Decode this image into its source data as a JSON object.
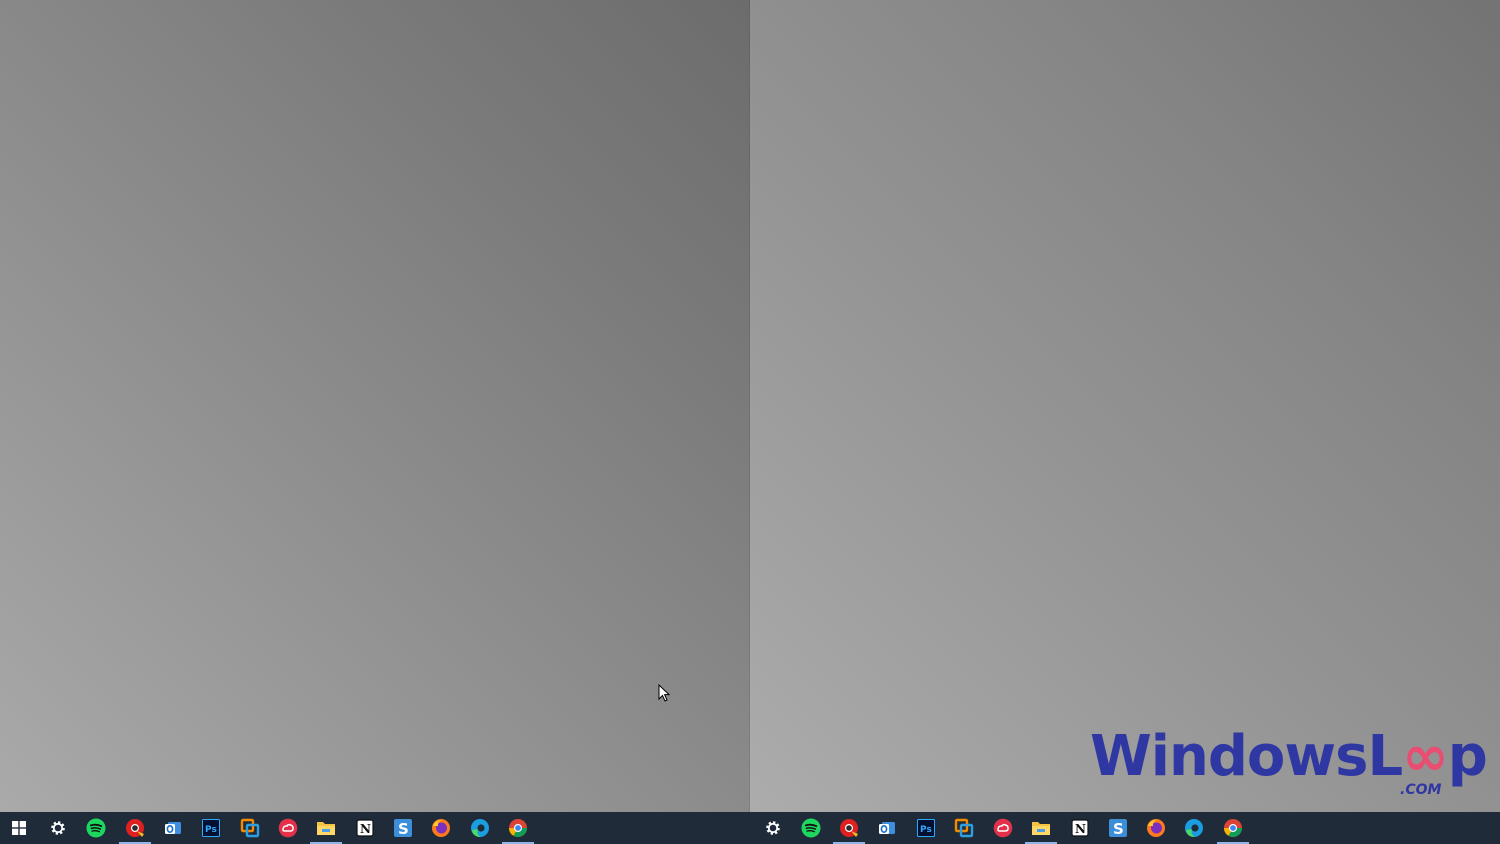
{
  "watermark": {
    "brand_main": "WindowsL",
    "brand_infinity": "∞",
    "brand_end": "p",
    "brand_suffix": ".COM",
    "colors": {
      "blue": "#2f37a3",
      "pink": "#e94e72"
    }
  },
  "taskbar_colors": {
    "background": "#202b3a",
    "active_indicator": "#8fb6e6"
  },
  "taskbar_left": {
    "items": [
      {
        "icon": "windows-start-icon"
      },
      {
        "icon": "gear-icon"
      },
      {
        "icon": "spotify-icon"
      },
      {
        "icon": "chrome-canary-icon",
        "active": true
      },
      {
        "icon": "outlook-icon"
      },
      {
        "icon": "photoshop-icon",
        "label": "Ps"
      },
      {
        "icon": "vmware-icon"
      },
      {
        "icon": "creative-cloud-icon"
      },
      {
        "icon": "file-explorer-icon",
        "active": true
      },
      {
        "icon": "notion-icon",
        "label": "N"
      },
      {
        "icon": "simplenote-icon",
        "label": "S"
      },
      {
        "icon": "firefox-icon"
      },
      {
        "icon": "edge-icon"
      },
      {
        "icon": "chrome-icon",
        "active": true
      }
    ]
  },
  "taskbar_right": {
    "items": [
      {
        "icon": "gear-icon"
      },
      {
        "icon": "spotify-icon"
      },
      {
        "icon": "chrome-canary-icon",
        "active": true
      },
      {
        "icon": "outlook-icon"
      },
      {
        "icon": "photoshop-icon",
        "label": "Ps"
      },
      {
        "icon": "vmware-icon"
      },
      {
        "icon": "creative-cloud-icon"
      },
      {
        "icon": "file-explorer-icon",
        "active": true
      },
      {
        "icon": "notion-icon",
        "label": "N"
      },
      {
        "icon": "simplenote-icon",
        "label": "S"
      },
      {
        "icon": "firefox-icon"
      },
      {
        "icon": "edge-icon"
      },
      {
        "icon": "chrome-icon",
        "active": true
      }
    ]
  }
}
